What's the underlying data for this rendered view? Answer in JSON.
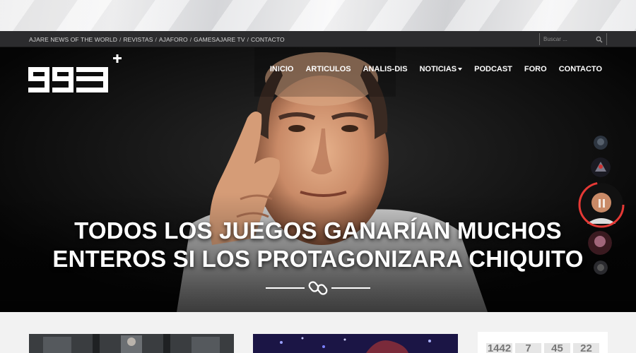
{
  "topbar": {
    "links": [
      "AJARE NEWS OF THE WORLD",
      "REVISTAS",
      "AJAFORO",
      "GAMESAJARE TV",
      "CONTACTO"
    ],
    "separator": "/",
    "search_placeholder": "Buscar ..."
  },
  "nav": {
    "items": [
      "INICIO",
      "ARTICULOS",
      "ANALIS-DIS",
      "NOTICIAS",
      "PODCAST",
      "FORO",
      "CONTACTO"
    ]
  },
  "hero": {
    "title_line1": "TODOS LOS JUEGOS GANARÍAN MUCHOS",
    "title_line2": "ENTEROS SI LOS PROTAGONIZARA CHIQUITO"
  },
  "widget": {
    "counters": [
      "1442",
      "7",
      "45",
      "22"
    ]
  },
  "colors": {
    "topbar_bg": "#2c2c2e",
    "hero_bg": "#050505",
    "accent_ring": "#e53935"
  }
}
